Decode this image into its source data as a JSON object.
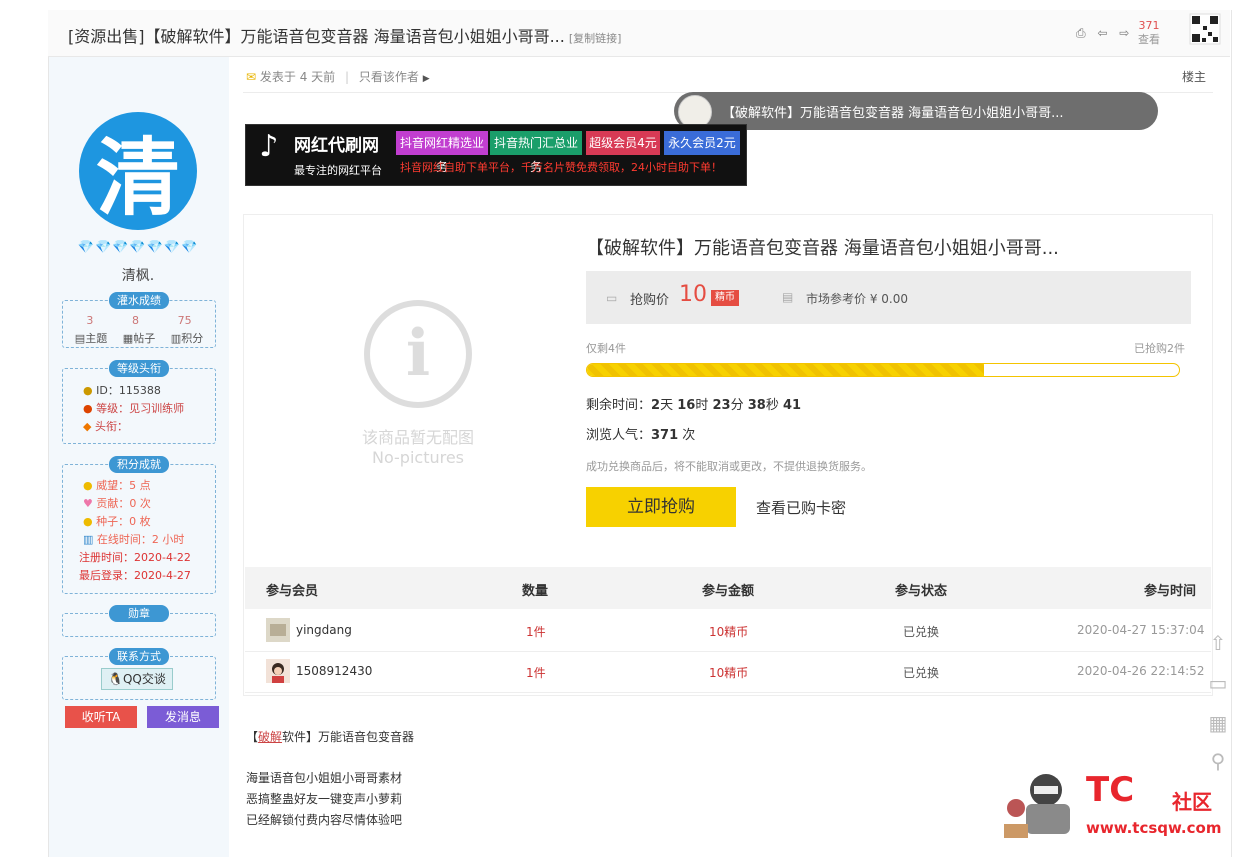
{
  "header": {
    "title": "[资源出售]【破解软件】万能语音包变音器 海量语音包小姐姐小哥哥...",
    "copy_link": "[复制链接]",
    "tools": "⎙ ⇦ ⇨",
    "view_count": "371",
    "view_label": "查看"
  },
  "sidebar": {
    "avatar_char": "清",
    "gems": "💎💎💎💎💎💎💎",
    "username": "清枫.",
    "stats_title": "灌水成绩",
    "stats": [
      {
        "value": "3",
        "label": "主题"
      },
      {
        "value": "8",
        "label": "帖子"
      },
      {
        "value": "75",
        "label": "积分"
      }
    ],
    "level_title": "等级头衔",
    "level_lines": [
      "ID：115388",
      "等级：见习训练师",
      "头衔："
    ],
    "points_title": "积分成就",
    "points_lines": [
      "威望：5 点",
      "贡献：0 次",
      "种子：0 枚",
      "在线时间：2 小时",
      "注册时间：2020-4-22",
      "最后登录：2020-4-27"
    ],
    "medal_title": "勋章",
    "contact_title": "联系方式",
    "qq_label": "QQ交谈",
    "follow_label": "收听TA",
    "message_label": "发消息"
  },
  "post_meta": {
    "posted": "发表于 4 天前",
    "separator": "|",
    "only_author": "只看该作者",
    "floor": "楼主"
  },
  "float_bar": {
    "text": "【破解软件】万能语音包变音器 海量语音包小姐姐小哥哥..."
  },
  "banner": {
    "logo": "♪",
    "name": "网红代刷网",
    "sub": "最专注的网红平台",
    "tags": [
      "抖音网红精选业务",
      "抖音热门汇总业务",
      "超级会员4元",
      "永久会员2元"
    ],
    "desc": "抖音网红自助下单平台，千万名片赞免费领取，24小时自助下单！"
  },
  "product": {
    "noimg_icon": "i",
    "noimg_text1": "该商品暂无配图",
    "noimg_text2": "No-pictures",
    "title": "【破解软件】万能语音包变音器 海量语音包小姐姐小哥哥...",
    "price_label": "抢购价",
    "price": "10",
    "currency": "精币",
    "market_label": "市场参考价 ¥ 0.00",
    "remaining": "仅剩4件",
    "sold": "已抢购2件",
    "progress": 0.67,
    "countdown_label": "剩余时间：",
    "countdown": {
      "d": "2",
      "d_u": "天",
      "h": "16",
      "h_u": "时",
      "m": "23",
      "m_u": "分",
      "s": "38",
      "s_u": "秒",
      "ms": "41"
    },
    "views_label": "浏览人气：",
    "views": "371",
    "views_unit": "次",
    "notice": "成功兑换商品后，将不能取消或更改，不提供退换货服务。",
    "buy_label": "立即抢购",
    "view_card": "查看已购卡密"
  },
  "table": {
    "headers": [
      "参与会员",
      "数量",
      "参与金额",
      "参与状态",
      "参与时间"
    ],
    "rows": [
      {
        "member": "yingdang",
        "qty": "1件",
        "amount": "10精币",
        "status": "已兑换",
        "time": "2020-04-27 15:37:04"
      },
      {
        "member": "1508912430",
        "qty": "1件",
        "amount": "10精币",
        "status": "已兑换",
        "time": "2020-04-26 22:14:52"
      }
    ]
  },
  "post": {
    "line1_a": "【",
    "line1_b": "破解",
    "line1_c": "软件】万能语音包变音器",
    "lines": [
      "海量语音包小姐姐小哥哥素材",
      "恶搞整蛊好友一键变声小萝莉",
      "已经解锁付费内容尽情体验吧"
    ]
  },
  "watermark": {
    "big": "TC",
    "big2": "社区",
    "url": "www.tcsqw.com"
  },
  "colors": {
    "accent": "#3d97d3",
    "price": "#e54d42",
    "buy": "#f7d100",
    "follow": "#e8524a",
    "message": "#7b5cd6"
  }
}
